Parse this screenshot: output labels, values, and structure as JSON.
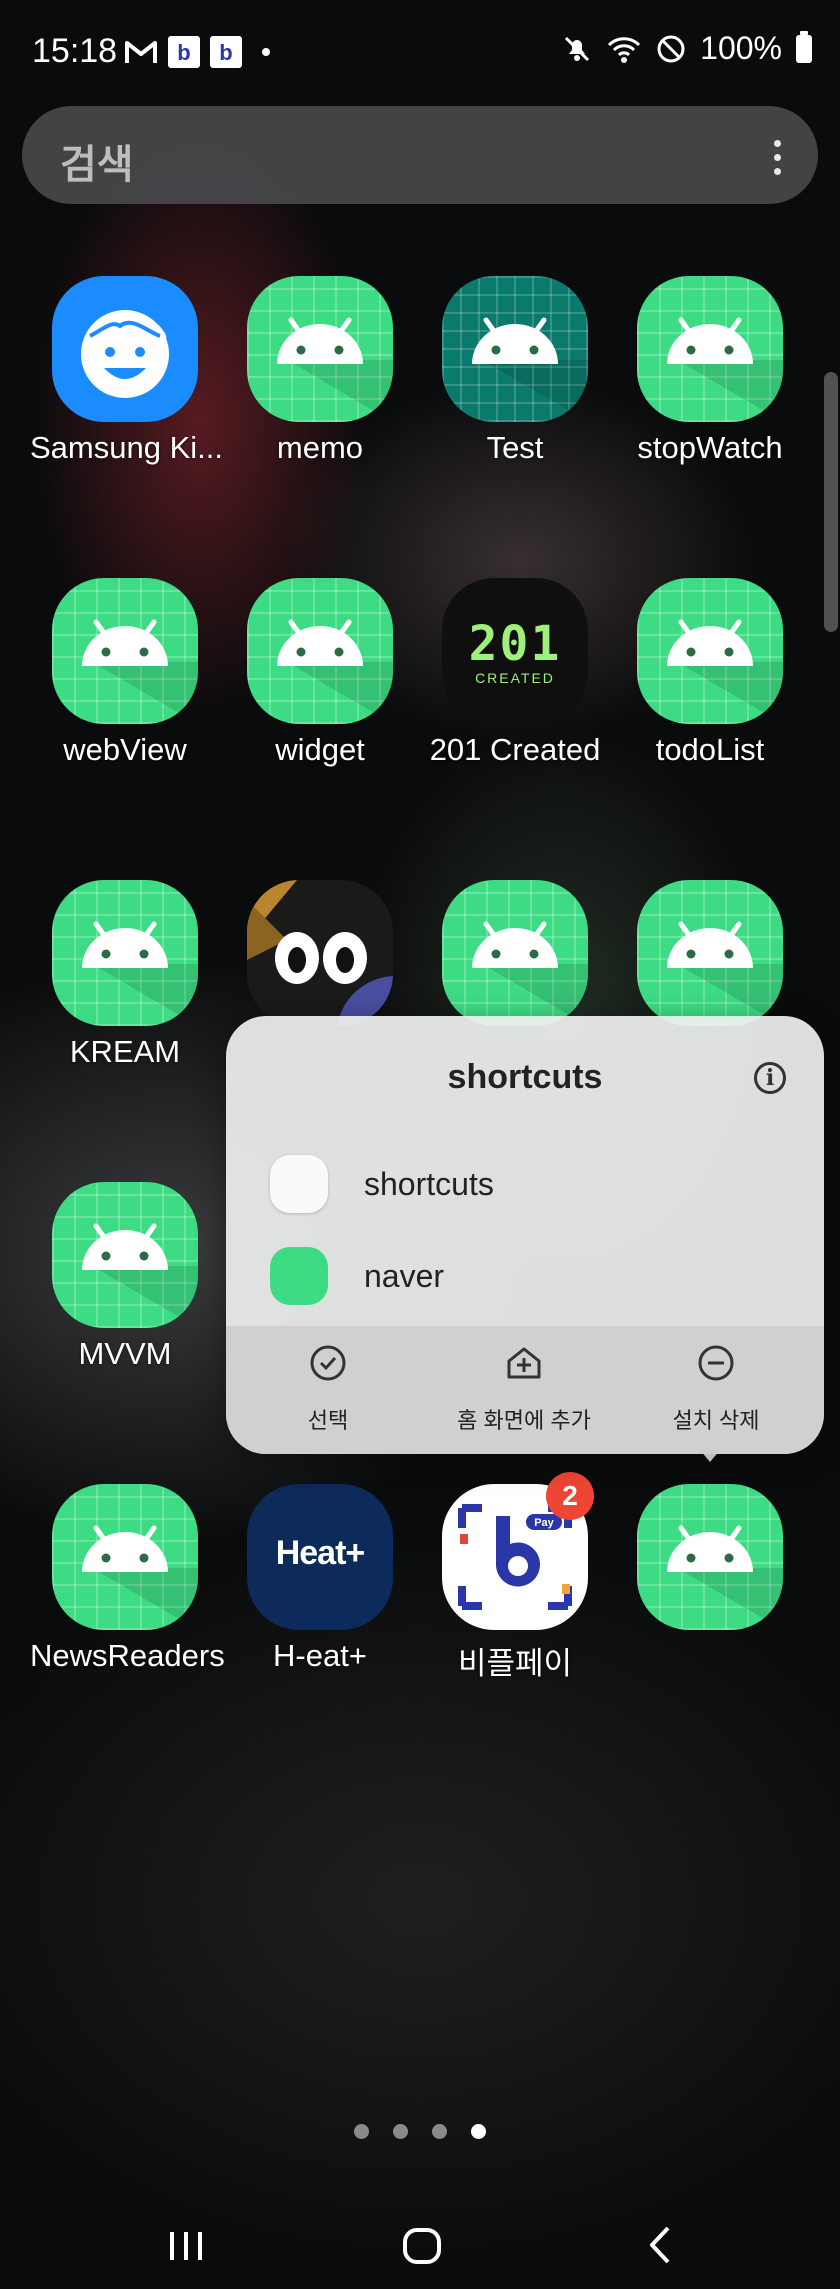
{
  "status_bar": {
    "time": "15:18",
    "left_icons": [
      "gmail-icon",
      "bpay-notification-icon",
      "bpay-notification-icon",
      "more-notifications-dot"
    ],
    "right_icons": [
      "mute-icon",
      "wifi-icon",
      "do-not-disturb-icon"
    ],
    "battery": "100%"
  },
  "search": {
    "placeholder": "검색"
  },
  "apps": [
    {
      "label": "Samsung Ki...",
      "icon": "samsung-kids-icon"
    },
    {
      "label": "memo",
      "icon": "android-icon"
    },
    {
      "label": "Test",
      "icon": "android-icon"
    },
    {
      "label": "stopWatch",
      "icon": "android-icon"
    },
    {
      "label": "webView",
      "icon": "android-icon"
    },
    {
      "label": "widget",
      "icon": "android-icon"
    },
    {
      "label": "201 Created",
      "icon": "201-created-icon",
      "icon_text": "201",
      "icon_subtext": "CREATED"
    },
    {
      "label": "todoList",
      "icon": "android-icon"
    },
    {
      "label": "KREAM",
      "icon": "android-icon"
    },
    {
      "label": "",
      "icon": "owl-app-icon"
    },
    {
      "label": "",
      "icon": "android-icon"
    },
    {
      "label": "",
      "icon": "android-icon"
    },
    {
      "label": "MVVM",
      "icon": "android-icon"
    },
    {
      "label": "NewsReaders",
      "icon": "android-icon"
    },
    {
      "label": "H-eat+",
      "icon": "heat-plus-icon",
      "icon_text": "Heat+"
    },
    {
      "label": "비플페이",
      "icon": "bpay-icon",
      "badge": "2",
      "icon_tag": "Pay"
    },
    {
      "label": "",
      "icon": "android-icon"
    }
  ],
  "popup": {
    "title": "shortcuts",
    "shortcuts": [
      {
        "label": "shortcuts"
      },
      {
        "label": "naver"
      }
    ],
    "actions": [
      {
        "label": "선택",
        "icon": "check-circle-icon"
      },
      {
        "label": "홈 화면에 추가",
        "icon": "add-home-icon"
      },
      {
        "label": "설치 삭제",
        "icon": "uninstall-icon"
      }
    ]
  },
  "pager": {
    "pages": 4,
    "current": 4
  },
  "navbar": {
    "buttons": [
      "recent-apps",
      "home",
      "back"
    ]
  },
  "colors": {
    "android_green": "#3ddc84",
    "samsung_blue": "#1a8cff",
    "badge_red": "#f04534"
  }
}
